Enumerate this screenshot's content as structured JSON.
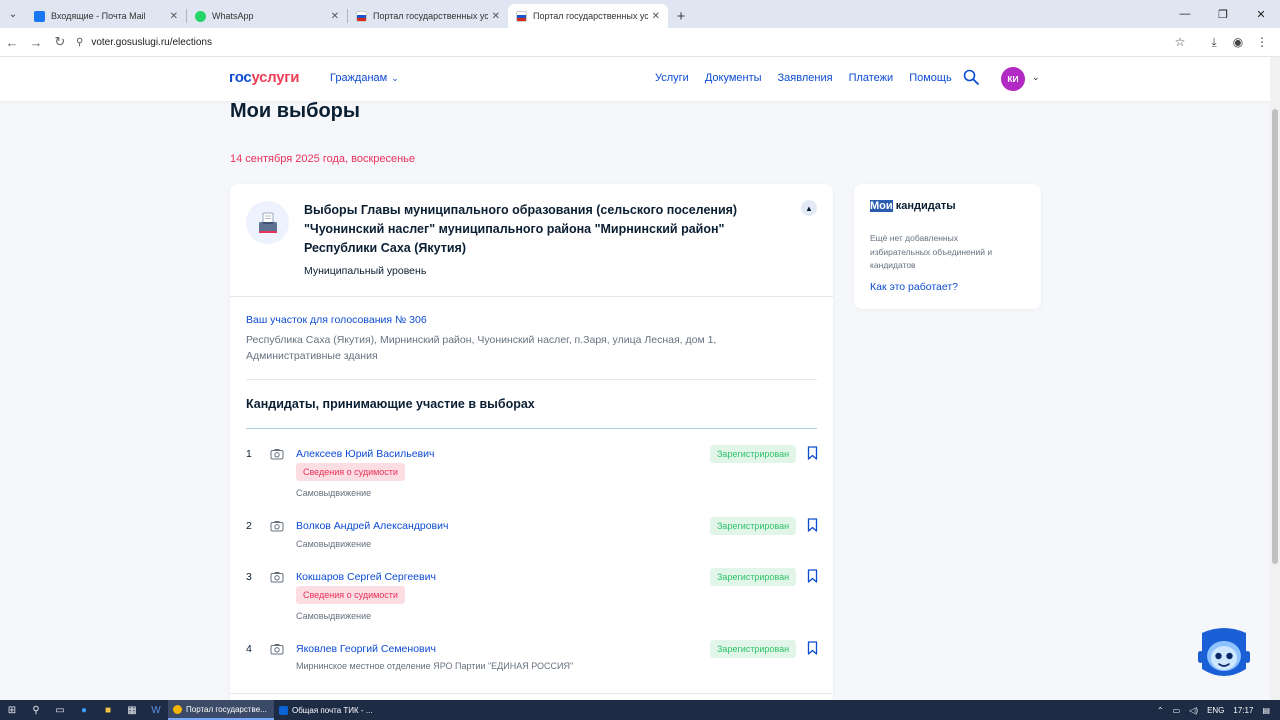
{
  "browser": {
    "tabs": [
      {
        "label": "Входящие - Почта Mail",
        "favicon_color": "#1877f2",
        "active": false
      },
      {
        "label": "WhatsApp",
        "favicon_color": "#25d366",
        "active": false
      },
      {
        "label": "Портал государственных услуг",
        "favicon_color": "#d52b1e",
        "active": false
      },
      {
        "label": "Портал государственных услуг",
        "favicon_color": "#d52b1e",
        "active": true
      }
    ],
    "new_tab_symbol": "+",
    "url": "voter.gosuslugi.ru/elections"
  },
  "header": {
    "logo_part1": "гос",
    "logo_part2": "услуги",
    "citizens_menu": "Гражданам",
    "nav": [
      "Услуги",
      "Документы",
      "Заявления",
      "Платежи",
      "Помощь"
    ],
    "avatar_initials": "КИ",
    "colors": {
      "brand_blue": "#0d4cd3",
      "brand_red": "#ee3f58",
      "avatar": "#b22ac4"
    }
  },
  "page": {
    "title": "Мои выборы",
    "date": "14 сентября 2025 года, воскресенье"
  },
  "election": {
    "title": "Выборы Главы муниципального образования (сельского поселения) \"Чуонинский наслег\" муниципального района \"Мирнинский район\" Республики Саха (Якутия)",
    "level": "Муниципальный уровень",
    "precinct_link": "Ваш участок для голосования № 306",
    "precinct_address": "Республика Саха (Якутия), Мирнинский район, Чуонинский наслег, п.Заря, улица Лесная, дом 1, Административные здания",
    "candidates_heading": "Кандидаты, принимающие участие в выборах",
    "candidates": [
      {
        "num": "1",
        "name": "Алексеев Юрий Васильевич",
        "criminal_record": "Сведения о судимости",
        "nomination": "Самовыдвижение",
        "status": "Зарегистрирован"
      },
      {
        "num": "2",
        "name": "Волков Андрей Александрович",
        "criminal_record": "",
        "nomination": "Самовыдвижение",
        "status": "Зарегистрирован"
      },
      {
        "num": "3",
        "name": "Кокшаров Сергей Сергеевич",
        "criminal_record": "Сведения о судимости",
        "nomination": "Самовыдвижение",
        "status": "Зарегистрирован"
      },
      {
        "num": "4",
        "name": "Яковлев Георгий Семенович",
        "criminal_record": "",
        "nomination": "Мирнинское местное отделение ЯРО Партии \"ЕДИНАЯ РОССИЯ\"",
        "status": "Зарегистрирован"
      }
    ]
  },
  "sidebar": {
    "title_highlight": "Мои",
    "title_rest": " кандидаты",
    "empty_text": "Ещё нет добавленных избирательных объединений и кандидатов",
    "how_link": "Как это работает?"
  },
  "taskbar": {
    "apps": [
      {
        "label": "Портал государстве...",
        "color": "#f4b400",
        "active": true
      },
      {
        "label": "Общая почта ТИК - ...",
        "color": "#0a64d6",
        "active": false
      }
    ],
    "lang": "ENG",
    "time": "17:17"
  }
}
